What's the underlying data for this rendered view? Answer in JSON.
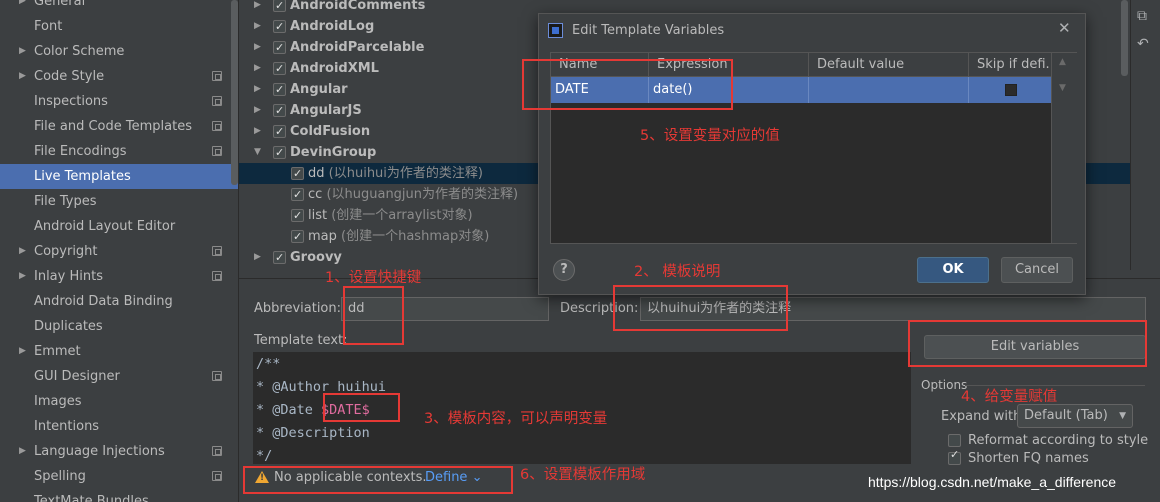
{
  "sidebar": {
    "items": [
      {
        "label": "General",
        "arrow": "▶",
        "copy": false,
        "selected": false
      },
      {
        "label": "Font",
        "arrow": "",
        "copy": false,
        "selected": false
      },
      {
        "label": "Color Scheme",
        "arrow": "▶",
        "copy": false,
        "selected": false
      },
      {
        "label": "Code Style",
        "arrow": "▶",
        "copy": true,
        "selected": false
      },
      {
        "label": "Inspections",
        "arrow": "",
        "copy": true,
        "selected": false
      },
      {
        "label": "File and Code Templates",
        "arrow": "",
        "copy": true,
        "selected": false
      },
      {
        "label": "File Encodings",
        "arrow": "",
        "copy": true,
        "selected": false
      },
      {
        "label": "Live Templates",
        "arrow": "",
        "copy": false,
        "selected": true
      },
      {
        "label": "File Types",
        "arrow": "",
        "copy": false,
        "selected": false
      },
      {
        "label": "Android Layout Editor",
        "arrow": "",
        "copy": false,
        "selected": false
      },
      {
        "label": "Copyright",
        "arrow": "▶",
        "copy": true,
        "selected": false
      },
      {
        "label": "Inlay Hints",
        "arrow": "▶",
        "copy": true,
        "selected": false
      },
      {
        "label": "Android Data Binding",
        "arrow": "",
        "copy": false,
        "selected": false
      },
      {
        "label": "Duplicates",
        "arrow": "",
        "copy": false,
        "selected": false
      },
      {
        "label": "Emmet",
        "arrow": "▶",
        "copy": false,
        "selected": false
      },
      {
        "label": "GUI Designer",
        "arrow": "",
        "copy": true,
        "selected": false
      },
      {
        "label": "Images",
        "arrow": "",
        "copy": false,
        "selected": false
      },
      {
        "label": "Intentions",
        "arrow": "",
        "copy": false,
        "selected": false
      },
      {
        "label": "Language Injections",
        "arrow": "▶",
        "copy": true,
        "selected": false
      },
      {
        "label": "Spelling",
        "arrow": "",
        "copy": true,
        "selected": false
      },
      {
        "label": "TextMate Bundles",
        "arrow": "",
        "copy": false,
        "selected": false
      }
    ]
  },
  "tree": {
    "groups_top": [
      "AndroidComments",
      "AndroidLog",
      "AndroidParcelable",
      "AndroidXML",
      "Angular",
      "AngularJS",
      "ColdFusion"
    ],
    "expanded_group": "DevinGroup",
    "children": [
      {
        "abbr": "dd",
        "desc": "(以huihui为作者的类注释)"
      },
      {
        "abbr": "cc",
        "desc": "(以huguangjun为作者的类注释)"
      },
      {
        "abbr": "list",
        "desc": "(创建一个arraylist对象)"
      },
      {
        "abbr": "map",
        "desc": "(创建一个hashmap对象)"
      }
    ],
    "group_after": "Groovy"
  },
  "form": {
    "abbreviation_label": "Abbreviation:",
    "abbreviation_value": "dd",
    "description_label": "Description:",
    "description_value": "以huihui为作者的类注释",
    "template_text_label": "Template text:",
    "edit_variables": "Edit variables",
    "options_label": "Options",
    "expand_with_label": "Expand with",
    "expand_with_value": "Default (Tab)",
    "reformat_label": "Reformat according to style",
    "shorten_label": "Shorten FQ names"
  },
  "editor": {
    "lines": [
      "/**",
      "* @Author huihui",
      "* @Date ",
      "* @Description",
      "*/"
    ],
    "variable": "$DATE$"
  },
  "status": {
    "text": "No applicable contexts.",
    "link": "Define",
    "link_arrow": "⌄"
  },
  "dialog": {
    "title": "Edit Template Variables",
    "columns": [
      "Name",
      "Expression",
      "Default value",
      "Skip if defi..."
    ],
    "row": {
      "name": "DATE",
      "expression": "date()",
      "default": "",
      "skip": true
    },
    "help": "?",
    "ok": "OK",
    "cancel": "Cancel"
  },
  "annotations": {
    "a1": "1、设置快捷键",
    "a2": "2、 模板说明",
    "a3": "3、模板内容，可以声明变量",
    "a4": "4、给变量赋值",
    "a5": "5、设置变量对应的值",
    "a6": "6、设置模板作用域"
  },
  "watermark": "https://blog.csdn.net/make_a_difference",
  "colors": {
    "accent": "#4b6eaf",
    "annotation": "#e53935",
    "warning": "#f0a732",
    "link": "#589df6",
    "variable": "#e06c9f"
  }
}
